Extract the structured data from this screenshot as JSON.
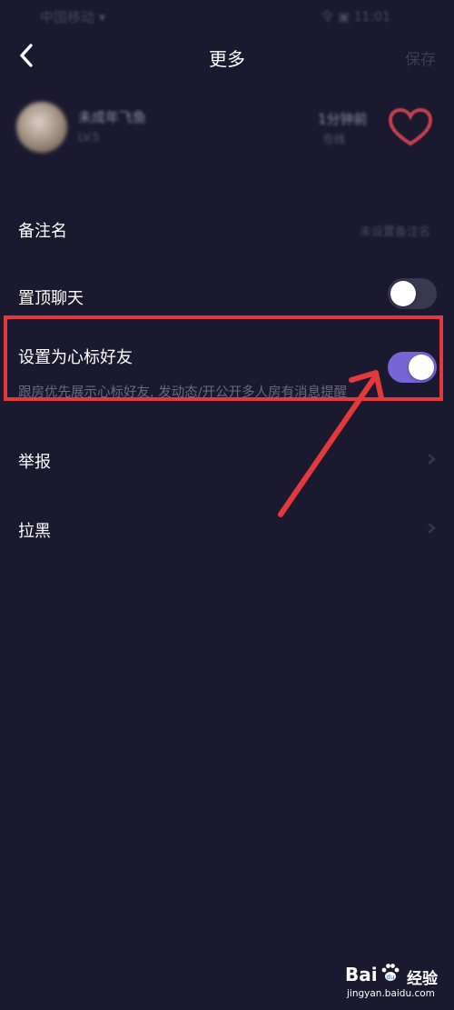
{
  "status_bar": {
    "carrier": "中国移动 ▾",
    "system": "令 ▣ 11:01"
  },
  "nav": {
    "title": "更多",
    "save_label": "保存"
  },
  "profile": {
    "name": "未成年飞鱼",
    "subtitle": "LV.5",
    "stat": "1分钟前",
    "stat_sub": "在线"
  },
  "rows": {
    "remark": {
      "label": "备注名",
      "value": "未设置备注名"
    },
    "pin_chat": {
      "label": "置顶聊天",
      "toggle": "off"
    },
    "close_friend": {
      "label": "设置为心标好友",
      "toggle": "on",
      "description": "跟房优先展示心标好友, 发动态/开公开多人房有消息提醒"
    },
    "report": {
      "label": "举报"
    },
    "block": {
      "label": "拉黑"
    }
  },
  "watermark": {
    "brand": "Bai",
    "suffix": "经验",
    "url": "jingyan.baidu.com"
  },
  "colors": {
    "background": "#1b1930",
    "toggle_on": "#7865d6",
    "toggle_off": "#3a3850",
    "annotation": "#e23a3c"
  }
}
